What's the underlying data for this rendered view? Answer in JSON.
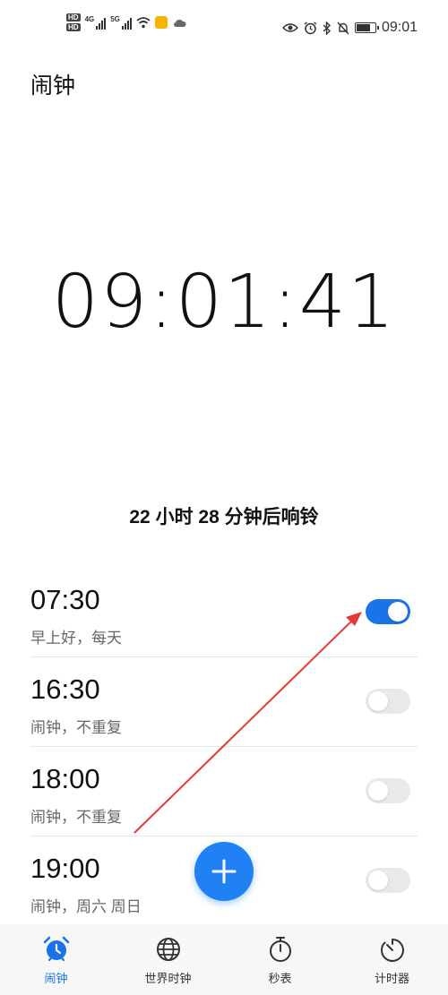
{
  "status_bar": {
    "hd1": "HD",
    "hd2": "HD",
    "sig1_label": "4G",
    "sig2_label": "5G",
    "time": "09:01",
    "battery_level": 0.8
  },
  "title": "闹钟",
  "clock": "09:01:41",
  "next_ring": "22 小时 28 分钟后响铃",
  "alarms": [
    {
      "time": "07:30",
      "label": "早上好，每天",
      "enabled": true
    },
    {
      "time": "16:30",
      "label": "闹钟，不重复",
      "enabled": false
    },
    {
      "time": "18:00",
      "label": "闹钟，不重复",
      "enabled": false
    },
    {
      "time": "19:00",
      "label": "闹钟，周六 周日",
      "enabled": false
    }
  ],
  "nav": [
    {
      "label": "闹钟",
      "icon": "alarm-clock-icon",
      "active": true
    },
    {
      "label": "世界时钟",
      "icon": "globe-icon",
      "active": false
    },
    {
      "label": "秒表",
      "icon": "stopwatch-icon",
      "active": false
    },
    {
      "label": "计时器",
      "icon": "timer-icon",
      "active": false
    }
  ],
  "colors": {
    "accent": "#1a73e8",
    "fab": "#2081f5",
    "annotation": "#e53935"
  }
}
